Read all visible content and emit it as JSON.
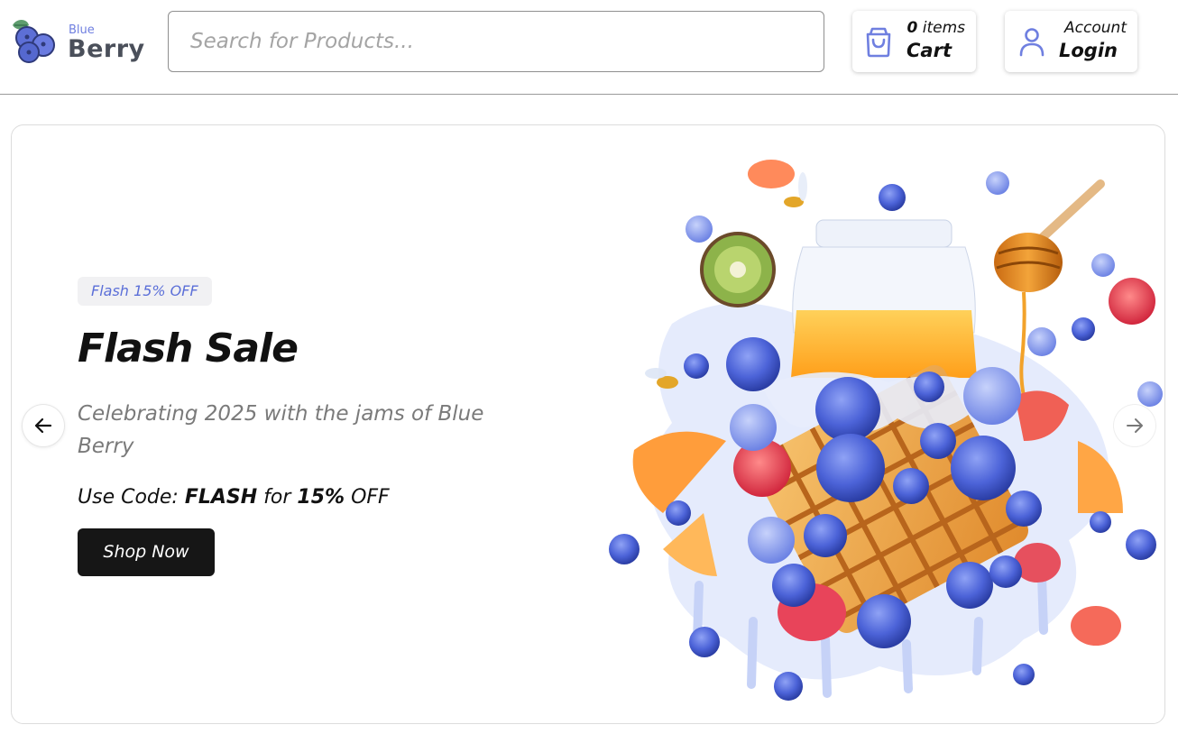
{
  "brand": {
    "small": "Blue",
    "big": "Berry",
    "colors": {
      "accent": "#6f7fe0",
      "text": "#4a4f5a",
      "berry": "#5d6fd6",
      "leaf": "#4f9a6a"
    }
  },
  "search": {
    "placeholder": "Search for Products...",
    "value": "",
    "icon": "none"
  },
  "cart": {
    "count": "0",
    "count_suffix": " items",
    "label": "Cart",
    "icon": "shopping-bag-icon",
    "icon_color": "#6f7fe0"
  },
  "account": {
    "top": "Account",
    "label": "Login",
    "icon": "user-icon",
    "icon_color": "#6f7fe0"
  },
  "hero": {
    "badge": "Flash 15% OFF",
    "title": "Flash Sale",
    "subtitle": "Celebrating 2025 with the jams of Blue Berry",
    "code_prefix": "Use Code: ",
    "code": "FLASH",
    "code_mid": " for ",
    "code_pct": "15%",
    "code_suffix": " OFF",
    "cta": "Shop Now",
    "image": "waffle-blueberry-jam-splash",
    "prev_icon": "arrow-left-icon",
    "next_icon": "arrow-right-icon"
  }
}
